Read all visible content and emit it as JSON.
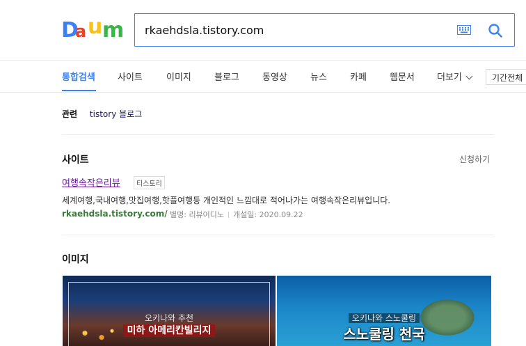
{
  "app": {
    "brand_colors": {
      "blue": "#3a82f7",
      "red": "#e8412a",
      "yellow": "#f6c21a",
      "green": "#3ab54a"
    }
  },
  "header": {
    "logo_icon": "daum-logo",
    "search": {
      "value": "rkaehdsla.tistory.com"
    },
    "keyboard_icon": "keyboard-icon",
    "search_icon": "search-icon"
  },
  "tabs": {
    "items": [
      "통합검색",
      "사이트",
      "이미지",
      "블로그",
      "동영상",
      "뉴스",
      "카페",
      "웹문서",
      "더보기"
    ],
    "active": "통합검색",
    "period_label": "기간전체"
  },
  "related": {
    "title": "관련",
    "link": "tistory 블로그"
  },
  "site_section": {
    "title": "사이트",
    "apply_label": "신청하기",
    "result": {
      "name": "여행속작은리뷰",
      "badge": "티스토리",
      "description": "세계여행,국내여행,맛집여행,핫플여행등 개인적인 느낌대로 적어나가는 여행속작은리뷰입니다.",
      "url": "rkaehdsla.tistory.com/",
      "alias": "별명: 리뷰어디노",
      "opened": "개설일: 2020.09.22"
    }
  },
  "image_section": {
    "title": "이미지",
    "images": [
      {
        "subtitle": "오키나와 추천",
        "title": "미하 아메리칸빌리지"
      },
      {
        "subtitle": "오키나와 스노쿨링",
        "title": "스노쿨링 천국"
      }
    ]
  }
}
